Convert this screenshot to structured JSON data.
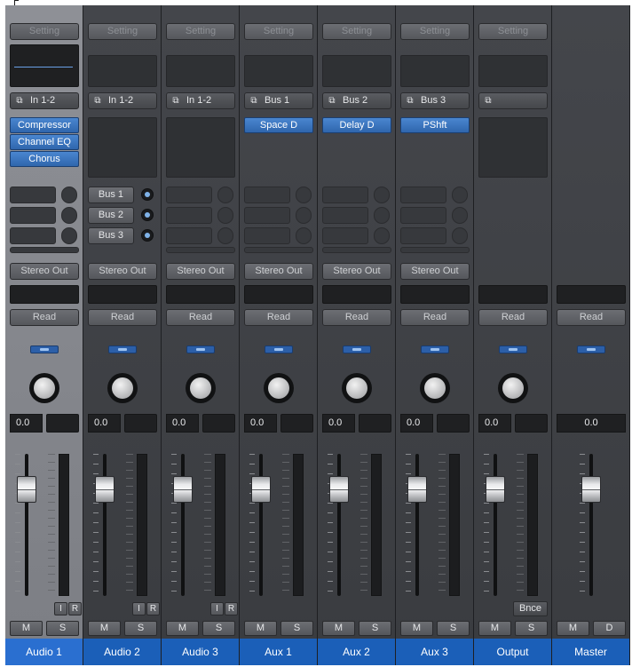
{
  "colors": {
    "accent": "#1b5fb8",
    "plugin": "#3a74c2",
    "background": "#3b3d41"
  },
  "strips": [
    {
      "name": "Audio 1",
      "setting": "Setting",
      "input": "In 1-2",
      "plugins": [
        "Compressor",
        "Channel EQ",
        "Chorus"
      ],
      "sends": [],
      "output": "Stereo Out",
      "automation": "Read",
      "volume": "0.0",
      "has_ir": true,
      "mute": "M",
      "solo": "S",
      "selected": true,
      "has_eq_thumb": true,
      "wide_readout": false
    },
    {
      "name": "Audio 2",
      "setting": "Setting",
      "input": "In 1-2",
      "plugins": [],
      "sends": [
        "Bus 1",
        "Bus 2",
        "Bus 3"
      ],
      "output": "Stereo Out",
      "automation": "Read",
      "volume": "0.0",
      "has_ir": true,
      "mute": "M",
      "solo": "S",
      "selected": false,
      "has_eq_thumb": false,
      "wide_readout": false
    },
    {
      "name": "Audio 3",
      "setting": "Setting",
      "input": "In 1-2",
      "plugins": [],
      "sends": [],
      "output": "Stereo Out",
      "automation": "Read",
      "volume": "0.0",
      "has_ir": true,
      "mute": "M",
      "solo": "S",
      "selected": false,
      "has_eq_thumb": false,
      "wide_readout": false
    },
    {
      "name": "Aux 1",
      "setting": "Setting",
      "input": "Bus 1",
      "plugins": [
        "Space D"
      ],
      "sends": [],
      "output": "Stereo Out",
      "automation": "Read",
      "volume": "0.0",
      "has_ir": false,
      "mute": "M",
      "solo": "S",
      "selected": false,
      "has_eq_thumb": false,
      "wide_readout": false
    },
    {
      "name": "Aux 2",
      "setting": "Setting",
      "input": "Bus 2",
      "plugins": [
        "Delay D"
      ],
      "sends": [],
      "output": "Stereo Out",
      "automation": "Read",
      "volume": "0.0",
      "has_ir": false,
      "mute": "M",
      "solo": "S",
      "selected": false,
      "has_eq_thumb": false,
      "wide_readout": false
    },
    {
      "name": "Aux 3",
      "setting": "Setting",
      "input": "Bus 3",
      "plugins": [
        "PShft"
      ],
      "sends": [],
      "output": "Stereo Out",
      "automation": "Read",
      "volume": "0.0",
      "has_ir": false,
      "mute": "M",
      "solo": "S",
      "selected": false,
      "has_eq_thumb": false,
      "wide_readout": false
    },
    {
      "name": "Output",
      "setting": "Setting",
      "input": "",
      "plugins": [],
      "sends": [],
      "output": "",
      "automation": "Read",
      "volume": "0.0",
      "has_ir": false,
      "bounce": "Bnce",
      "mute": "M",
      "solo": "S",
      "selected": false,
      "has_eq_thumb": false,
      "wide_readout": false
    },
    {
      "name": "Master",
      "setting": "",
      "input": null,
      "plugins": [],
      "sends": [],
      "output": "",
      "automation": "Read",
      "volume": "0.0",
      "has_ir": false,
      "mute": "M",
      "solo": "D",
      "selected": false,
      "has_eq_thumb": false,
      "wide_readout": true
    }
  ],
  "ir_labels": {
    "input": "I",
    "record": "R"
  }
}
